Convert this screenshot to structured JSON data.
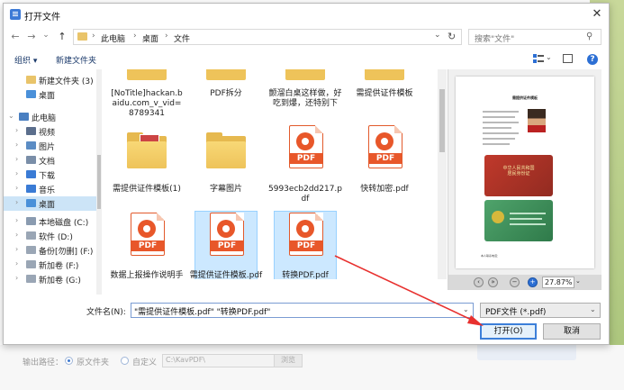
{
  "dialog": {
    "title": "打开文件",
    "close_glyph": "✕"
  },
  "nav": {
    "back_glyph": "←",
    "forward_glyph": "→",
    "dropdown_glyph": "⌄",
    "up_glyph": "↑",
    "breadcrumbs": [
      "此电脑",
      "桌面",
      "文件"
    ],
    "sep_glyph": "›",
    "refresh_glyph": "↻",
    "search_placeholder": "搜索\"文件\""
  },
  "toolbar": {
    "organize": "组织 ▾",
    "new_folder": "新建文件夹",
    "help": "?"
  },
  "sidebar": {
    "items": [
      {
        "label": "新建文件夹 (3)",
        "icon": "folder-icon",
        "color": "#e9c46a"
      },
      {
        "label": "桌面",
        "icon": "desktop-folder-icon",
        "color": "#4a90d9"
      },
      {
        "label": "此电脑",
        "icon": "computer-icon",
        "color": "#4a7fc1"
      },
      {
        "label": "视频",
        "icon": "video-icon",
        "color": "#5b6e8c"
      },
      {
        "label": "图片",
        "icon": "pictures-icon",
        "color": "#5b8cc4"
      },
      {
        "label": "文档",
        "icon": "documents-icon",
        "color": "#7a8ea8"
      },
      {
        "label": "下载",
        "icon": "download-icon",
        "color": "#3a7bd5"
      },
      {
        "label": "音乐",
        "icon": "music-icon",
        "color": "#3a7bd5"
      },
      {
        "label": "桌面",
        "icon": "desktop-icon",
        "color": "#4a90d9"
      },
      {
        "label": "本地磁盘 (C:)",
        "icon": "drive-icon",
        "color": "#8a9bb0"
      },
      {
        "label": "软件 (D:)",
        "icon": "drive-icon",
        "color": "#9aa6b5"
      },
      {
        "label": "备份[勿删] (F:)",
        "icon": "drive-icon",
        "color": "#9aa6b5"
      },
      {
        "label": "新加卷 (F:)",
        "icon": "drive-icon",
        "color": "#9aa6b5"
      },
      {
        "label": "新加卷 (G:)",
        "icon": "drive-icon",
        "color": "#9aa6b5"
      }
    ],
    "expand_glyph": "›",
    "expanded_glyph": "⌄"
  },
  "files": {
    "row0": [
      "[NoTitle]hackan.baidu.com_v_vid=8789341",
      "PDF拆分",
      "颤溜白桌这样做，好吃到爆，还特别下",
      "需提供证件模板"
    ],
    "row1": [
      "需提供证件模板(1)",
      "字幕图片",
      "5993ecb2dd217.pdf",
      "快转加密.pdf"
    ],
    "row2": [
      "数据上报操作说明手册.pdf",
      "需提供证件模板.pdf",
      "转换PDF.pdf"
    ],
    "pdf_badge": "PDF"
  },
  "preview": {
    "page_title": "需提供证件模板",
    "idcard_text": "中华人民共和国\n居民身份证",
    "footer_text": "本人联系电话：",
    "zoom": "27.87%",
    "tool_glyphs": [
      "‹",
      "»",
      "−",
      "+"
    ]
  },
  "bottom": {
    "filename_label": "文件名(N):",
    "filename_value": "\"需提供证件模板.pdf\" \"转换PDF.pdf\"",
    "filetype_value": "PDF文件 (*.pdf)",
    "open_label": "打开(O)",
    "cancel_label": "取消",
    "dd_glyph": "⌄"
  },
  "background_app": {
    "output_label": "输出路径：",
    "radio_source": "原文件夹",
    "radio_custom": "自定义",
    "path_value": "C:\\KavPDF\\",
    "browse_label": "浏览"
  }
}
